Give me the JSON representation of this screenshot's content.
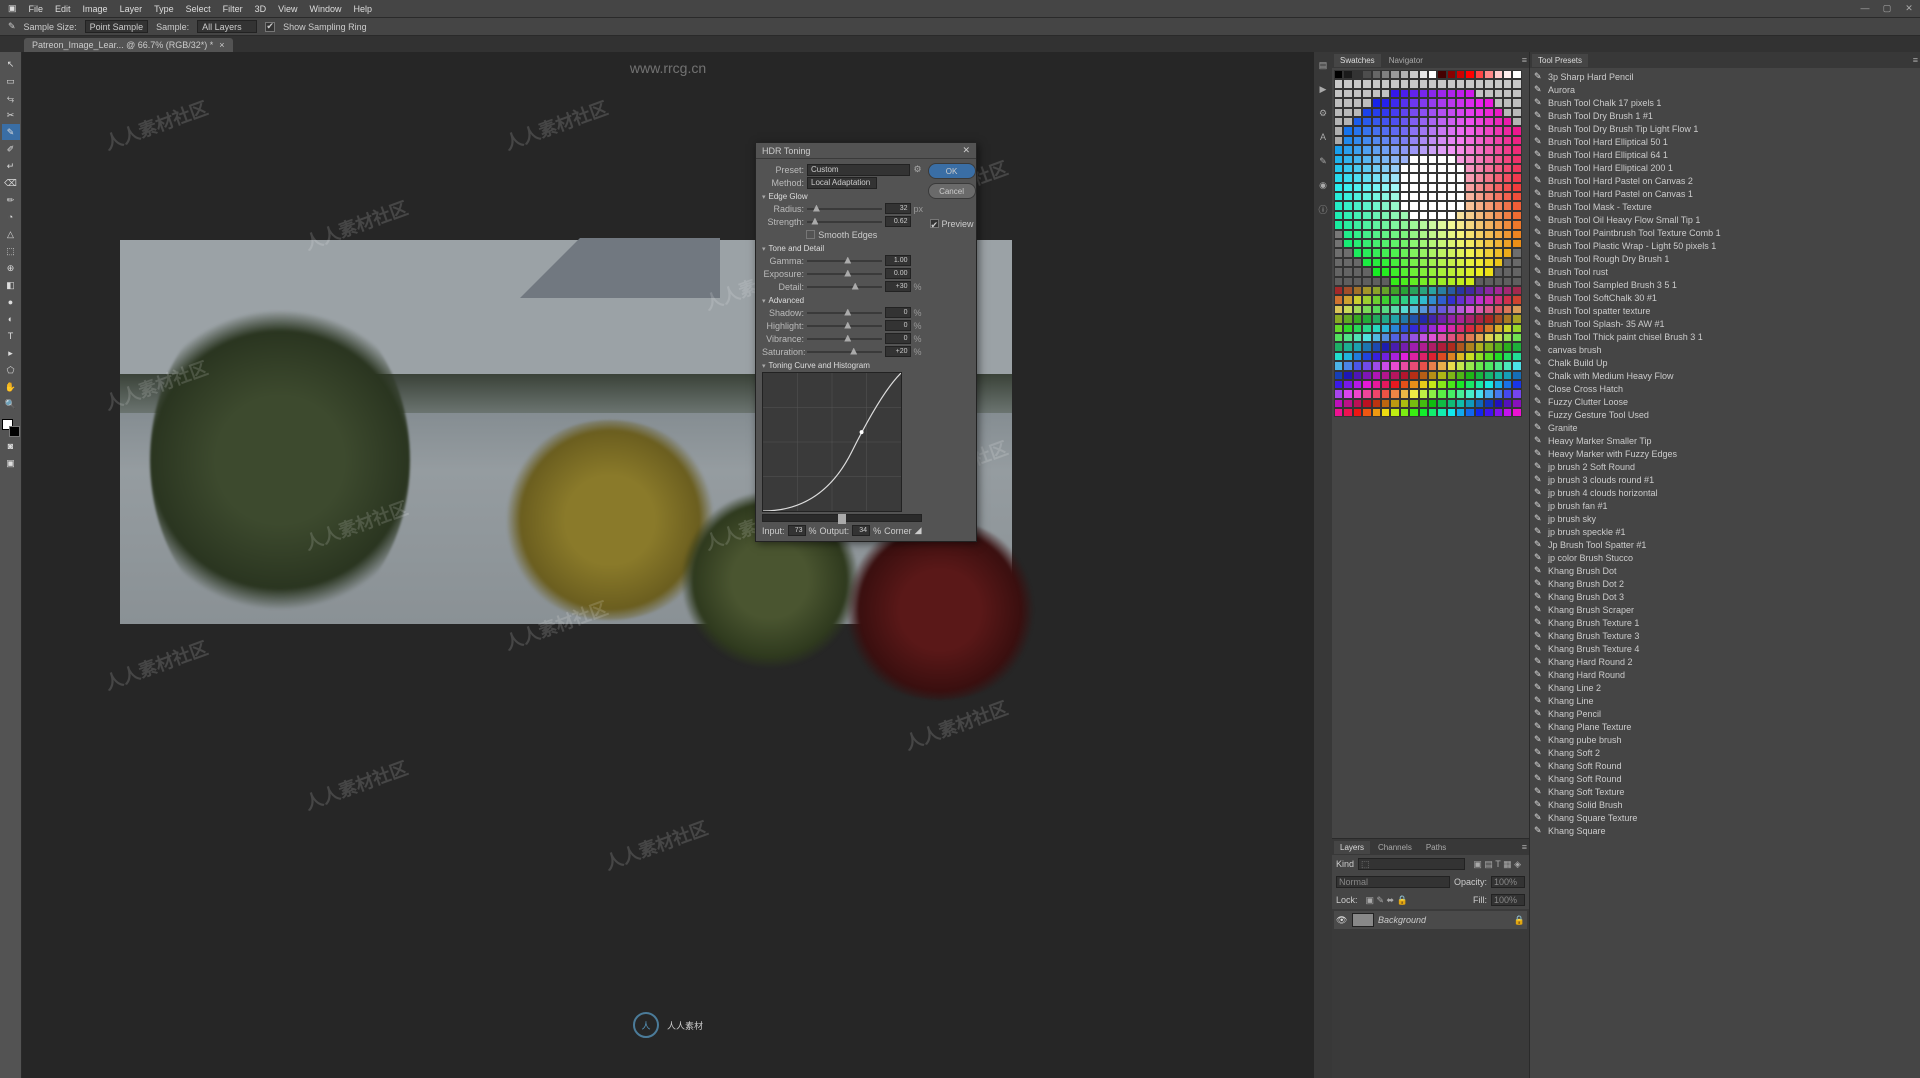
{
  "menu": [
    "File",
    "Edit",
    "Image",
    "Layer",
    "Type",
    "Select",
    "Filter",
    "3D",
    "View",
    "Window",
    "Help"
  ],
  "optbar": {
    "sample_size_lbl": "Sample Size:",
    "sample_size": "Point Sample",
    "sample_lbl": "Sample:",
    "sample": "All Layers",
    "ring": "Show Sampling Ring"
  },
  "doc": {
    "tab": "Patreon_Image_Lear... @ 66.7% (RGB/32*) *"
  },
  "tools": [
    "↖",
    "▭",
    "⥃",
    "✂",
    "✎",
    "✐",
    "↵",
    "⌫",
    "✏",
    "◔",
    "△",
    "⬚",
    "⊕",
    "◧",
    "●",
    "◐",
    "T",
    "▸",
    "⬠",
    "✋",
    "🔍"
  ],
  "panels": {
    "swatches_tabs": [
      "Swatches",
      "Navigator"
    ],
    "layers_tabs": [
      "Layers",
      "Channels",
      "Paths"
    ],
    "layers": {
      "kind": "Kind",
      "mode": "Normal",
      "opacity_lbl": "Opacity:",
      "opacity": "100%",
      "lock": "Lock:",
      "fill_lbl": "Fill:",
      "fill": "100%",
      "bg": "Background"
    },
    "tool_presets_title": "Tool Presets",
    "tool_presets": [
      "3p Sharp Hard Pencil",
      "Aurora",
      "Brush Tool Chalk 17 pixels 1",
      "Brush Tool Dry Brush 1 #1",
      "Brush Tool Dry Brush Tip Light Flow 1",
      "Brush Tool Hard Elliptical 50 1",
      "Brush Tool Hard Elliptical 64 1",
      "Brush Tool Hard Elliptical 200 1",
      "Brush Tool Hard Pastel on Canvas 2",
      "Brush Tool Hard Pastel on Canvas 1",
      "Brush Tool Mask - Texture",
      "Brush Tool Oil Heavy Flow Small Tip 1",
      "Brush Tool Paintbrush Tool Texture Comb 1",
      "Brush Tool Plastic Wrap - Light 50 pixels 1",
      "Brush Tool Rough Dry Brush 1",
      "Brush Tool rust",
      "Brush Tool Sampled Brush 3 5 1",
      "Brush Tool SoftChalk 30 #1",
      "Brush Tool spatter texture",
      "Brush Tool Splash- 35 AW #1",
      "Brush Tool Thick paint chisel Brush 3 1",
      "canvas brush",
      "Chalk Build Up",
      "Chalk with Medium Heavy Flow",
      "Close Cross Hatch",
      "Fuzzy Clutter Loose",
      "Fuzzy Gesture Tool Used",
      "Granite",
      "Heavy Marker Smaller Tip",
      "Heavy Marker with Fuzzy Edges",
      "jp brush 2 Soft Round",
      "jp brush 3 clouds round #1",
      "jp brush 4 clouds horizontal",
      "jp brush fan #1",
      "jp brush sky",
      "jp brush speckle #1",
      "Jp Brush Tool Spatter #1",
      "jp color Brush Stucco",
      "Khang Brush Dot",
      "Khang Brush Dot 2",
      "Khang Brush Dot 3",
      "Khang Brush Scraper",
      "Khang Brush Texture 1",
      "Khang Brush Texture 3",
      "Khang Brush Texture 4",
      "Khang Hard Round 2",
      "Khang Hard Round",
      "Khang Line 2",
      "Khang Line",
      "Khang Pencil",
      "Khang Plane Texture",
      "Khang pube brush",
      "Khang Soft 2",
      "Khang Soft Round",
      "Khang Soft Round",
      "Khang Soft Texture",
      "Khang Solid Brush",
      "Khang Square Texture",
      "Khang Square"
    ]
  },
  "dialog": {
    "title": "HDR Toning",
    "preset_lbl": "Preset:",
    "preset": "Custom",
    "method_lbl": "Method:",
    "method": "Local Adaptation",
    "ok": "OK",
    "cancel": "Cancel",
    "preview": "Preview",
    "sections": {
      "edge": "Edge Glow",
      "tone": "Tone and Detail",
      "adv": "Advanced",
      "curve": "Toning Curve and Histogram"
    },
    "sliders": {
      "radius": {
        "lbl": "Radius:",
        "val": "32",
        "unit": "px",
        "pos": 8
      },
      "strength": {
        "lbl": "Strength:",
        "val": "0.62",
        "unit": "",
        "pos": 6
      },
      "smooth": "Smooth Edges",
      "gamma": {
        "lbl": "Gamma:",
        "val": "1.00",
        "unit": "",
        "pos": 50
      },
      "exposure": {
        "lbl": "Exposure:",
        "val": "0.00",
        "unit": "",
        "pos": 50
      },
      "detail": {
        "lbl": "Detail:",
        "val": "+30",
        "unit": "%",
        "pos": 60
      },
      "shadow": {
        "lbl": "Shadow:",
        "val": "0",
        "unit": "%",
        "pos": 50
      },
      "highlight": {
        "lbl": "Highlight:",
        "val": "0",
        "unit": "%",
        "pos": 50
      },
      "vibrance": {
        "lbl": "Vibrance:",
        "val": "0",
        "unit": "%",
        "pos": 50
      },
      "saturation": {
        "lbl": "Saturation:",
        "val": "+20",
        "unit": "%",
        "pos": 58
      }
    },
    "io": {
      "input_lbl": "Input:",
      "input": "73",
      "pct1": "%",
      "output_lbl": "Output:",
      "output": "34",
      "pct2": "%",
      "corner": "Corner"
    }
  },
  "wm": {
    "text": "人人素材社区",
    "url": "www.rrcg.cn",
    "logo": "人人素材"
  },
  "swatch_colors": [
    [
      "#000",
      "#444",
      "#666",
      "#888",
      "#aaa",
      "#ccc",
      "#eee",
      "#fff",
      "#800",
      "#f00",
      "#f80",
      "#ff0",
      "#8f0",
      "#0f0",
      "#0f8",
      "#0ff",
      "#08f",
      "#00f",
      "#80f",
      "#f0f"
    ]
  ]
}
